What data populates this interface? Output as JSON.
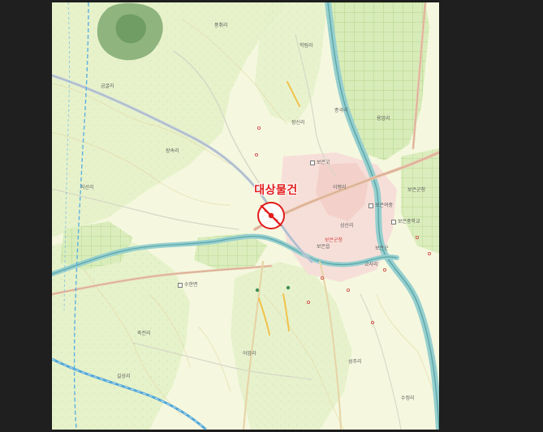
{
  "map": {
    "target_label": "대상물건",
    "place_labels": [
      "보은군청",
      "보은군",
      "보은군청",
      "보은고",
      "보은여중",
      "수한면",
      "보은중학교",
      "보은읍",
      "장신리",
      "삼산리",
      "교사리",
      "이평리",
      "종곡리",
      "학림리",
      "풍취리",
      "죽전리",
      "어암리",
      "용암리",
      "금굴리",
      "지산리",
      "장속리",
      "길상리",
      "성주리",
      "수정리"
    ],
    "colors": {
      "background": "#f5f8df",
      "forest": "#d8ecb9",
      "dense_forest": "#8fb47e",
      "urban": "#f7dfd9",
      "road": "#a7b7c8",
      "river": "#5da6a7",
      "river_fill": "#96cfcf",
      "rail": "#4da5d8",
      "marker": "#e31b1b",
      "field_grid": "#c4dfa1",
      "contour": "#e4d7a5"
    }
  }
}
